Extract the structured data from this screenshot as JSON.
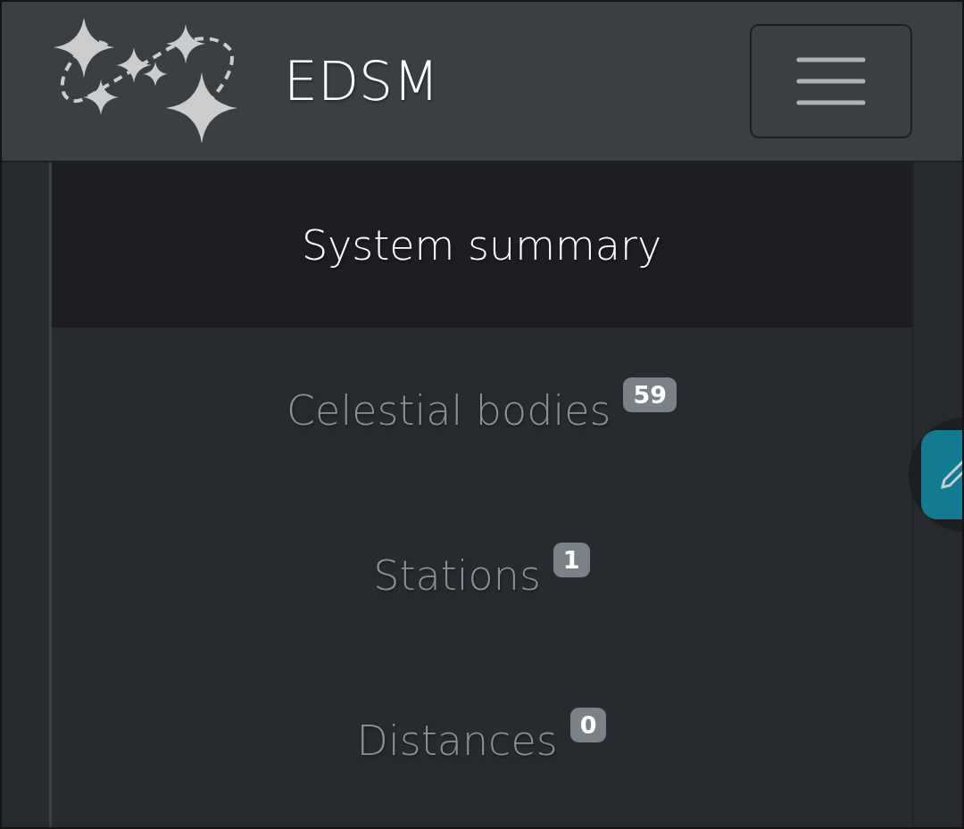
{
  "navbar": {
    "brand": "EDSM"
  },
  "menu": [
    {
      "label": "System summary",
      "selected": true
    },
    {
      "label": "Celestial bodies",
      "badge": "59",
      "selected": false
    },
    {
      "label": "Stations",
      "badge": "1",
      "selected": false
    },
    {
      "label": "Distances",
      "badge": "0",
      "selected": false
    }
  ]
}
